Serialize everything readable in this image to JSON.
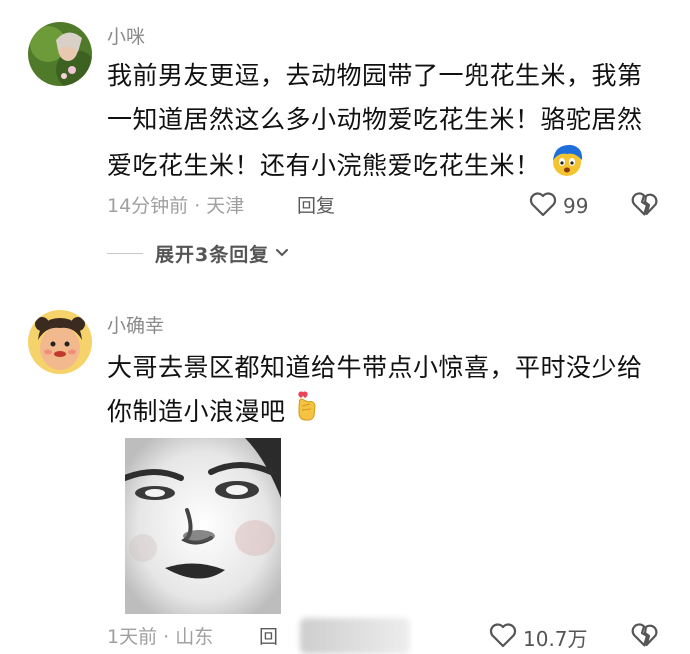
{
  "comments": [
    {
      "username": "小咪",
      "text_lines": [
        "我前男友更逗，去动物园带了一兜花生米，我第",
        "一知道居然这么多小动物爱吃花生米！骆驼居然",
        "爱吃花生米！还有小浣熊爱吃花生米！"
      ],
      "meta": "14分钟前 · 天津",
      "reply_label": "回复",
      "likes": "99",
      "expand_label": "展开3条回复"
    },
    {
      "username": "小确幸",
      "text_lines": [
        "大哥去景区都知道给牛带点小惊喜，平时没少给",
        "你制造小浪漫吧"
      ],
      "meta": "1天前 · 山东",
      "reply_label": "回",
      "likes": "10.7万"
    }
  ],
  "icons": {
    "like": "heart-outline-icon",
    "dislike": "broken-heart-icon",
    "expand_arrow": "chevron-down-icon",
    "emoji_1": "surprised-blue-hair-emoji",
    "emoji_2": "finger-heart-emoji"
  },
  "colors": {
    "username": "#8a8a8a",
    "text": "#111111",
    "meta": "#a0a0a0"
  }
}
